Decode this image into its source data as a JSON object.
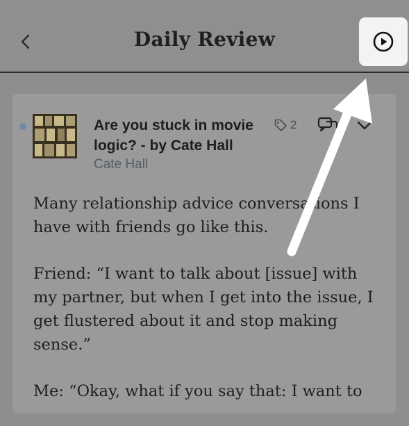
{
  "header": {
    "title": "Daily Review",
    "back_icon": "chevron-left-icon",
    "play_icon": "play-circle-icon"
  },
  "item": {
    "title": "Are you stuck in movie logic? - by Cate Hall",
    "author": "Cate Hall",
    "tag_count": "2",
    "unread_dot_color": "#6f8aa6"
  },
  "content": {
    "paragraphs": [
      "Many relationship advice conversations I have with friends go like this.",
      "Friend: “I want to talk about [issue] with my partner, but when I get into the issue, I get flustered about it and stop making sense.”",
      "Me: “Okay, what if you say that: I want to"
    ]
  },
  "colors": {
    "overlay": "#8e8e8e",
    "play_button_bg": "#f2f3f5",
    "arrow": "#ffffff"
  }
}
